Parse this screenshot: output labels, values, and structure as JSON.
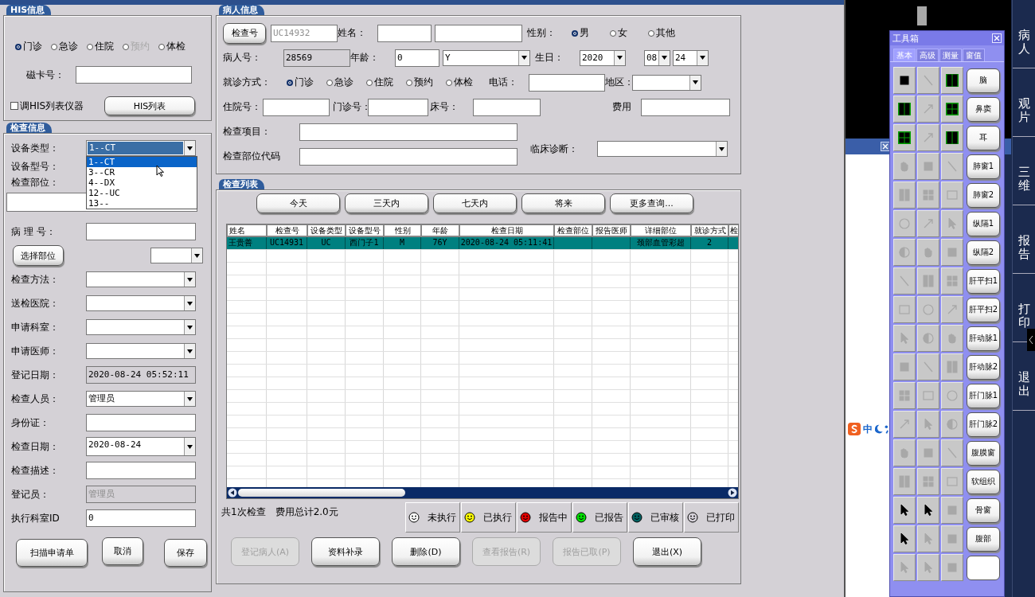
{
  "his_info": {
    "title": "HIS信息",
    "visit_types": [
      {
        "label": "门诊",
        "selected": true,
        "disabled": false
      },
      {
        "label": "急诊",
        "selected": false,
        "disabled": false
      },
      {
        "label": "住院",
        "selected": false,
        "disabled": false
      },
      {
        "label": "预约",
        "selected": false,
        "disabled": true
      },
      {
        "label": "体检",
        "selected": false,
        "disabled": false
      }
    ],
    "card_label": "磁卡号：",
    "checkbox": {
      "label": "调HIS列表仪器",
      "checked": false
    },
    "list_button": "HIS列表"
  },
  "exam_info": {
    "title": "检查信息",
    "fields": [
      {
        "kind": "dropdown",
        "label": "设备类型：",
        "value": "1--CT",
        "highlighted": true,
        "open": true,
        "options": [
          {
            "label": "1--CT",
            "selected": true
          },
          {
            "label": "3--CR",
            "selected": false
          },
          {
            "label": "4--DX",
            "selected": false
          },
          {
            "label": "12--UC",
            "selected": false
          },
          {
            "label": "13--",
            "selected": false
          }
        ]
      },
      {
        "kind": "label",
        "label": "设备型号："
      },
      {
        "kind": "wide",
        "label": "检查部位："
      },
      {
        "kind": "text",
        "label": "病 理 号："
      },
      {
        "kind": "button_dropdown",
        "label": "选择部位"
      },
      {
        "kind": "dropdown",
        "label": "检查方法："
      },
      {
        "kind": "dropdown",
        "label": "送检医院："
      },
      {
        "kind": "dropdown",
        "label": "申请科室："
      },
      {
        "kind": "dropdown",
        "label": "申请医师："
      },
      {
        "kind": "readonly",
        "label": "登记日期：",
        "value": "2020-08-24 05:52:11",
        "disabled": false
      },
      {
        "kind": "dropdown",
        "label": "检查人员：",
        "value": "管理员"
      },
      {
        "kind": "text",
        "label": "身份证："
      },
      {
        "kind": "date",
        "label": "检查日期：",
        "value": "2020-08-24"
      },
      {
        "kind": "text",
        "label": "检查描述："
      },
      {
        "kind": "readonly",
        "label": "登记员：",
        "value": "管理员",
        "disabled": true
      },
      {
        "kind": "text",
        "label": "执行科室ID",
        "value": "0"
      }
    ],
    "buttons": [
      "扫描申请单",
      "取消",
      "保存"
    ]
  },
  "patient_info": {
    "title": "病人信息",
    "exam_no_button": "检查号",
    "exam_no": "UC14932",
    "name_label": "姓名：",
    "gender_label": "性别：",
    "genders": [
      {
        "label": "男",
        "selected": true
      },
      {
        "label": "女",
        "selected": false
      },
      {
        "label": "其他",
        "selected": false
      }
    ],
    "patient_no_label": "病人号：",
    "patient_no": "28569",
    "age_label": "年龄：",
    "age": "0",
    "age_unit": "Y",
    "birthday_label": "生日：",
    "birthday": [
      "2020",
      "08",
      "24"
    ],
    "visit_label": "就诊方式：",
    "visits": [
      {
        "label": "门诊",
        "selected": true
      },
      {
        "label": "急诊",
        "selected": false
      },
      {
        "label": "住院",
        "selected": false
      },
      {
        "label": "预约",
        "selected": false
      },
      {
        "label": "体检",
        "selected": false
      }
    ],
    "phone_label": "电话：",
    "region_label": "地区：",
    "inpatient_label": "住院号：",
    "outpatient_label": "门诊号：",
    "bed_label": "床号：",
    "fee_label": "费用",
    "items_label": "检查项目：",
    "diagnosis_label": "临床诊断：",
    "site_code_label": "检查部位代码"
  },
  "exam_list": {
    "title": "检查列表",
    "range_buttons": [
      "今天",
      "三天内",
      "七天内",
      "将来",
      "更多查询..."
    ],
    "table": {
      "columns": [
        "姓名",
        "检查号",
        "设备类型",
        "设备型号",
        "性别",
        "年龄",
        "检查日期",
        "检查部位",
        "报告医师",
        "详细部位",
        "就诊方式",
        "检"
      ],
      "rows": [
        {
          "selected": true,
          "cells": [
            "王贵善",
            "UC14931",
            "UC",
            "西门子1",
            "M",
            "76Y",
            "2020-08-24 05:11:41",
            null,
            null,
            "颈部血管彩超",
            "2",
            null
          ]
        }
      ]
    },
    "summary": [
      "共1次检查",
      "费用总计2.0元"
    ],
    "status_legend": [
      {
        "label": "未执行",
        "color": "#ffffff"
      },
      {
        "label": "已执行",
        "color": "#ffff00"
      },
      {
        "label": "报告中",
        "color": "#e00000"
      },
      {
        "label": "已报告",
        "color": "#00e000"
      },
      {
        "label": "已审核",
        "color": "#006060"
      },
      {
        "label": "已打印",
        "color": "#d4d0d8"
      }
    ],
    "actions": [
      {
        "label": "登记病人(A)",
        "disabled": true
      },
      {
        "label": "资料补录",
        "disabled": false
      },
      {
        "label": "删除(D)",
        "disabled": false
      },
      {
        "label": "查看报告(R)",
        "disabled": true
      },
      {
        "label": "报告已取(P)",
        "disabled": true
      },
      {
        "label": "退出(X)",
        "disabled": false
      }
    ]
  },
  "toolbox": {
    "title": "工具箱",
    "tabs": [
      {
        "label": "基本",
        "selected": true
      },
      {
        "label": "高级",
        "selected": false
      },
      {
        "label": "测量",
        "selected": false
      },
      {
        "label": "窗值",
        "selected": false
      }
    ],
    "tools": [
      [
        true,
        false,
        true
      ],
      [
        true,
        false,
        true
      ],
      [
        true,
        false,
        true
      ],
      [
        false,
        false,
        false
      ],
      [
        false,
        false,
        false
      ],
      [
        false,
        false,
        false
      ],
      [
        false,
        false,
        false
      ],
      [
        false,
        false,
        false
      ],
      [
        false,
        false,
        false
      ],
      [
        false,
        false,
        false
      ],
      [
        false,
        false,
        false
      ],
      [
        false,
        false,
        false
      ],
      [
        false,
        false,
        false
      ],
      [
        false,
        false,
        false
      ],
      [
        false,
        false,
        false
      ],
      [
        true,
        true,
        false
      ],
      [
        true,
        false,
        false
      ],
      [
        false,
        false,
        false
      ]
    ],
    "presets": [
      "脑",
      "鼻窦",
      "耳",
      "肺窗1",
      "肺窗2",
      "纵隔1",
      "纵隔2",
      "肝平扫1",
      "肝平扫2",
      "肝动脉1",
      "肝动脉2",
      "肝门脉1",
      "肝门脉2",
      "腹膜窗",
      "软组织",
      "骨窗",
      "腹部"
    ]
  },
  "ime_bar": {
    "mode": "中"
  },
  "side_nav": [
    "病人",
    "观片",
    "三维",
    "报告",
    "打印",
    "退出"
  ]
}
